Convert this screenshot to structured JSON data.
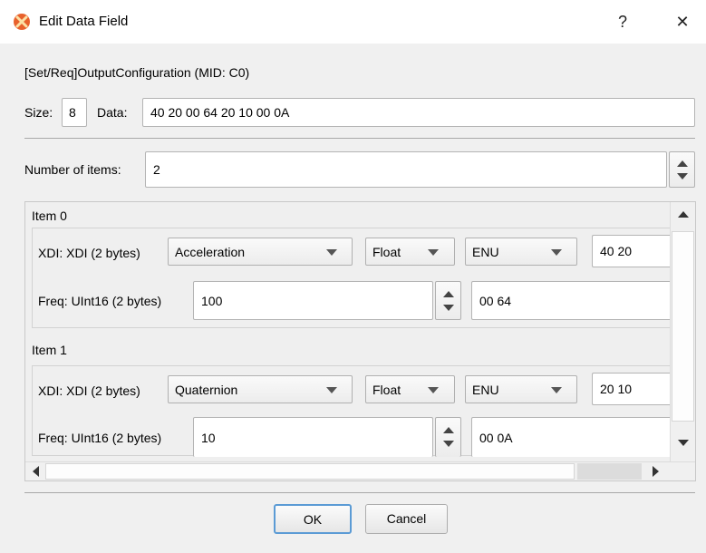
{
  "window": {
    "title": "Edit Data Field",
    "help_glyph": "?",
    "close_glyph": "✕"
  },
  "header": {
    "text": "[Set/Req]OutputConfiguration (MID: C0)"
  },
  "size": {
    "label": "Size:",
    "value": "8"
  },
  "data": {
    "label": "Data:",
    "value": "40 20 00 64 20 10 00 0A"
  },
  "number_of_items": {
    "label": "Number of items:",
    "value": "2"
  },
  "items": [
    {
      "title": "Item 0",
      "xdi_label": "XDI: XDI (2 bytes)",
      "xdi_type": "Acceleration",
      "format": "Float",
      "frame": "ENU",
      "xdi_hex": "40 20",
      "freq_label": "Freq: UInt16 (2 bytes)",
      "freq_value": "100",
      "freq_hex": "00 64"
    },
    {
      "title": "Item 1",
      "xdi_label": "XDI: XDI (2 bytes)",
      "xdi_type": "Quaternion",
      "format": "Float",
      "frame": "ENU",
      "xdi_hex": "20 10",
      "freq_label": "Freq: UInt16 (2 bytes)",
      "freq_value": "10",
      "freq_hex": "00 0A"
    }
  ],
  "buttons": {
    "ok": "OK",
    "cancel": "Cancel"
  },
  "colors": {
    "title_bg": "#ffffff",
    "dialog_bg": "#f0f0f0",
    "accent_border": "#5b9bd5",
    "app_icon": "#e8612c"
  },
  "icons": {
    "app": "app-icon",
    "help": "help-icon",
    "close": "close-icon"
  }
}
